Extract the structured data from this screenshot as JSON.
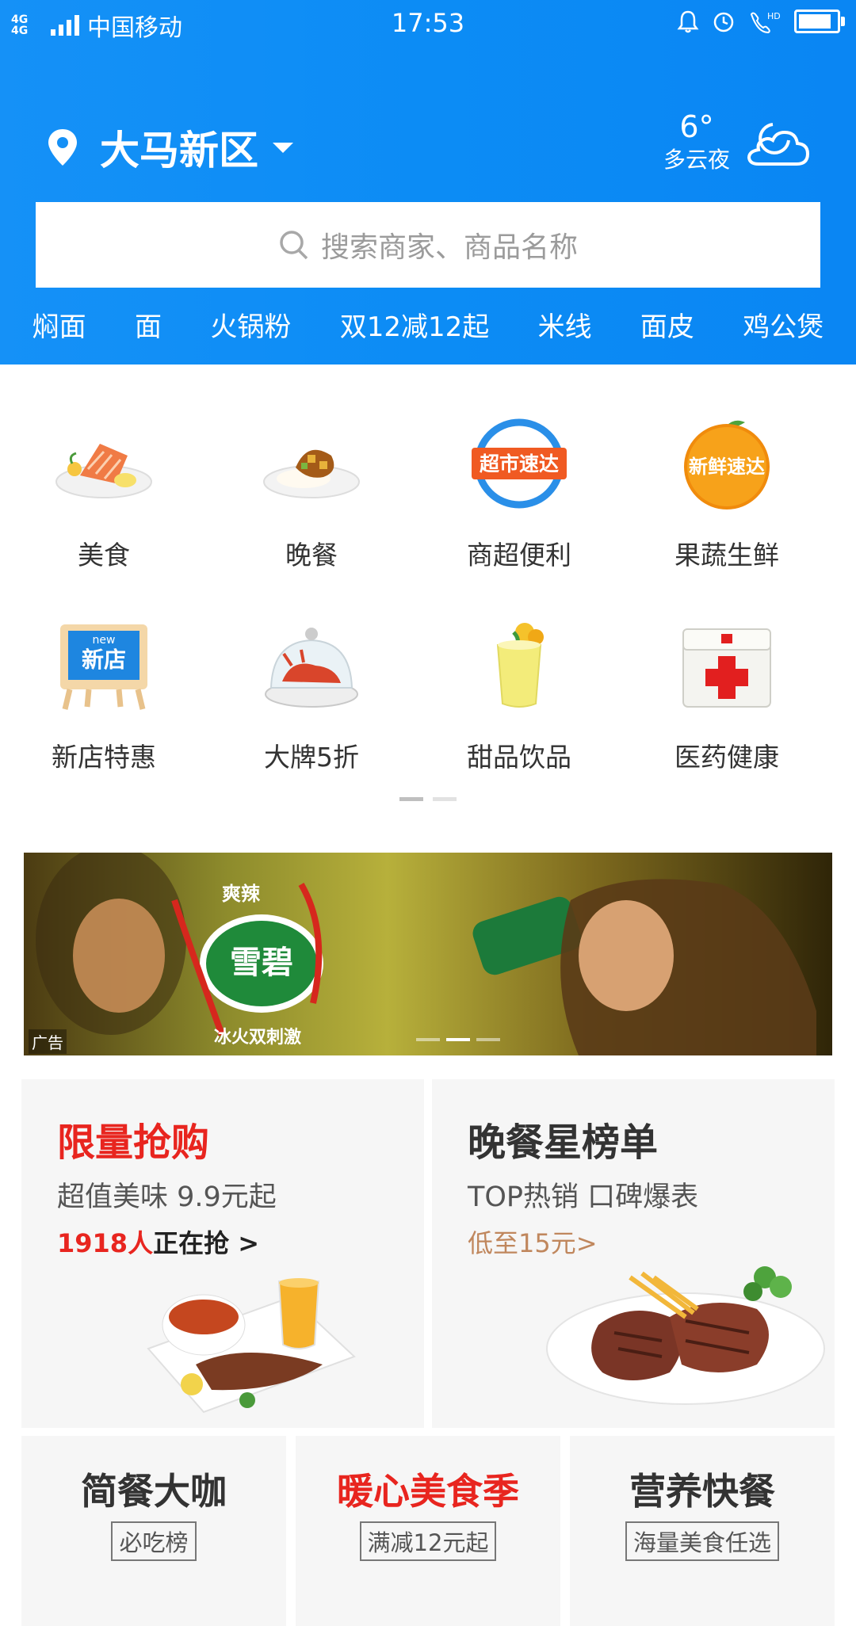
{
  "status_bar": {
    "network": "4G 4G",
    "carrier": "中国移动",
    "time": "17:53",
    "hd": "HD"
  },
  "location": {
    "city": "大马新区"
  },
  "weather": {
    "temp": "6°",
    "condition": "多云夜",
    "icon": "cloud-night-icon"
  },
  "search": {
    "placeholder": "搜索商家、商品名称"
  },
  "hot_words": [
    "焖面",
    "面",
    "火锅粉",
    "双12减12起",
    "米线",
    "面皮",
    "鸡公煲"
  ],
  "categories": [
    {
      "label": "美食",
      "icon": "food-salmon-icon"
    },
    {
      "label": "晚餐",
      "icon": "dinner-rice-icon"
    },
    {
      "label": "商超便利",
      "icon": "supermarket-express-icon",
      "icon_text": "超市速达"
    },
    {
      "label": "果蔬生鲜",
      "icon": "fresh-express-icon",
      "icon_text": "新鲜速达"
    },
    {
      "label": "新店特惠",
      "icon": "new-store-icon",
      "icon_text": "新店",
      "icon_badge": "new"
    },
    {
      "label": "大牌5折",
      "icon": "lobster-dome-icon"
    },
    {
      "label": "甜品饮品",
      "icon": "drink-cup-icon"
    },
    {
      "label": "医药健康",
      "icon": "medicine-kit-icon"
    }
  ],
  "page_indicator": {
    "pages": 2,
    "active": 1
  },
  "banner": {
    "ad_label": "广告",
    "brand": "雪碧",
    "slogan_top": "爽辣",
    "slogan_bottom": "冰火双刺激",
    "pages": 3,
    "active": 2
  },
  "promo": {
    "flash": {
      "title": "限量抢购",
      "subtitle": "超值美味 9.9元起",
      "count": "1918人",
      "count_suffix": "正在抢 >",
      "title_color": "#e8251f"
    },
    "dinner_rank": {
      "title": "晚餐星榜单",
      "subtitle": "TOP热销 口碑爆表",
      "price_note": "低至15元>",
      "title_color": "#333333"
    }
  },
  "mini_cards": [
    {
      "title": "简餐大咖",
      "tag": "必吃榜",
      "color": "#333333"
    },
    {
      "title": "暖心美食季",
      "tag": "满减12元起",
      "color": "#e8251f"
    },
    {
      "title": "营养快餐",
      "tag": "海量美食任选",
      "color": "#333333"
    }
  ]
}
